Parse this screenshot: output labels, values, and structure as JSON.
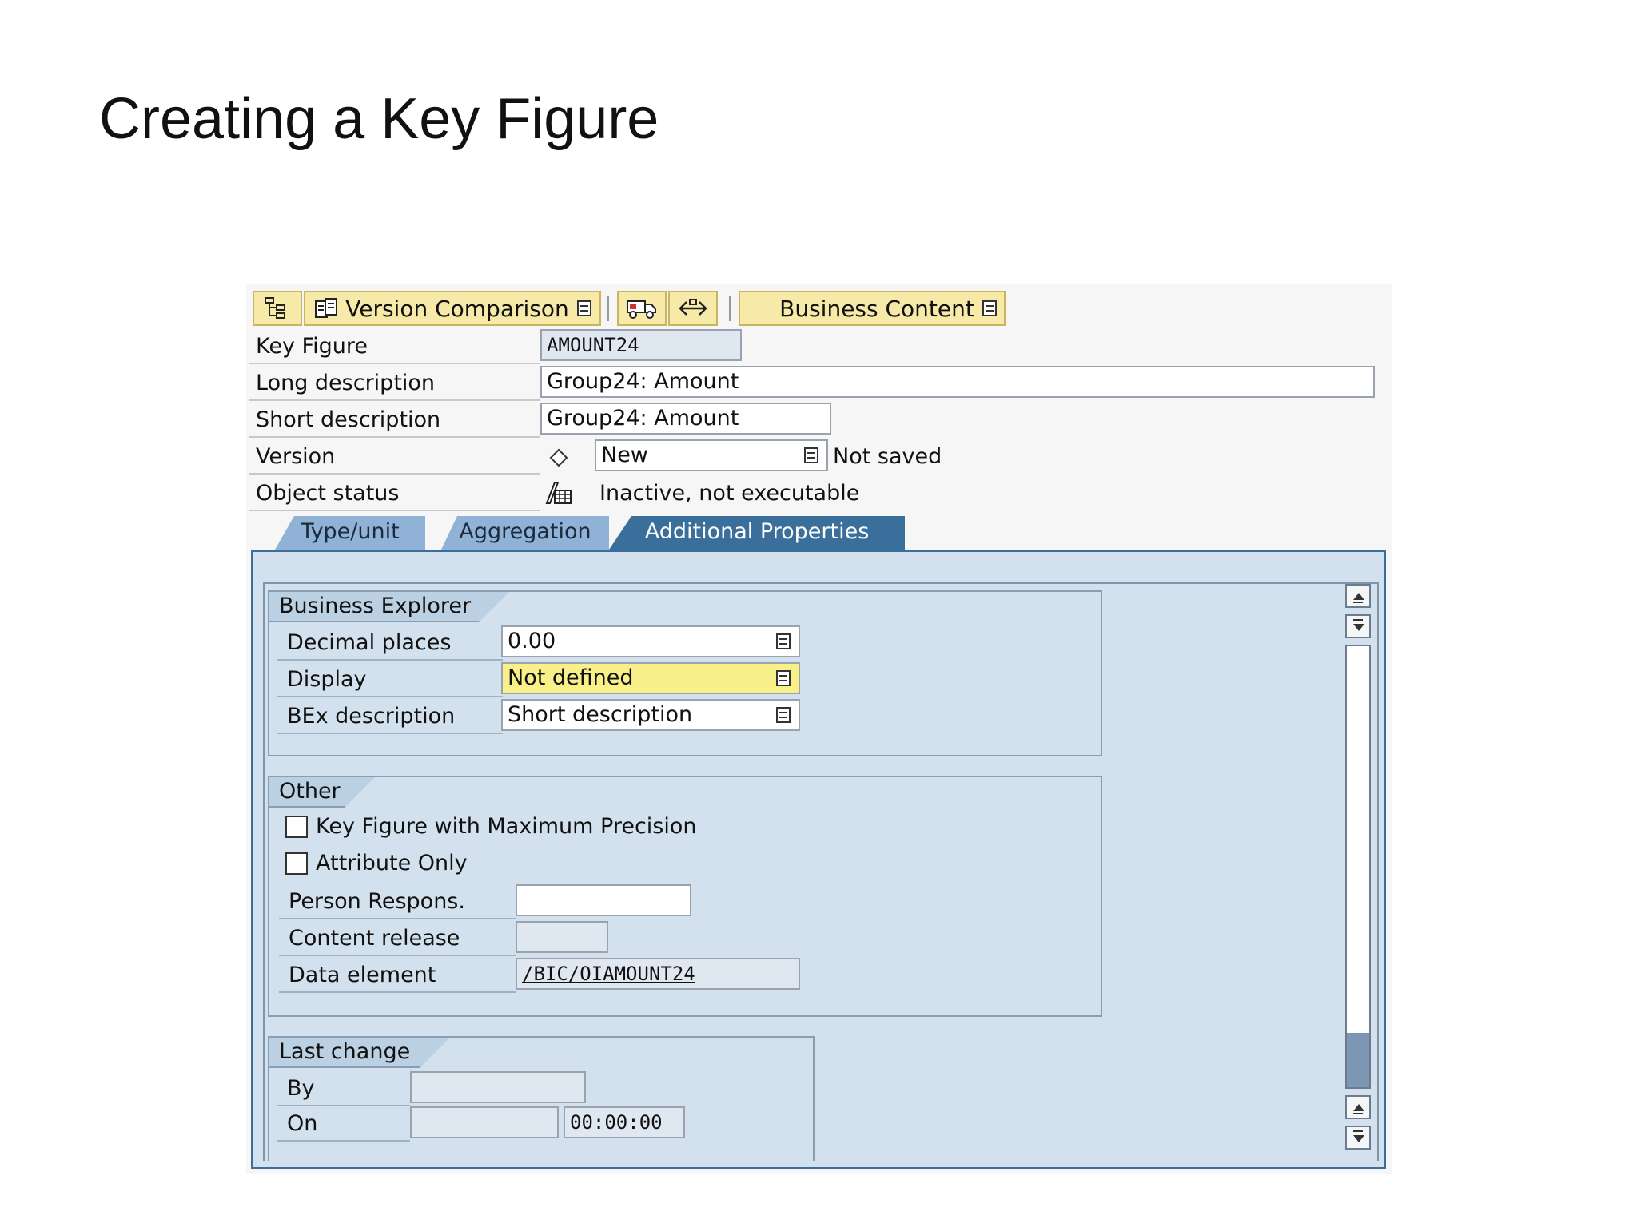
{
  "slide": {
    "title": "Creating a Key Figure"
  },
  "toolbar": {
    "version_comparison": "Version Comparison",
    "business_content": "Business Content"
  },
  "header": {
    "key_figure": {
      "label": "Key Figure",
      "value": "AMOUNT24"
    },
    "long_description": {
      "label": "Long description",
      "value": "Group24: Amount"
    },
    "short_description": {
      "label": "Short description",
      "value": "Group24: Amount"
    },
    "version": {
      "label": "Version",
      "value": "New",
      "status": "Not saved"
    },
    "object_status": {
      "label": "Object status",
      "value": "Inactive, not executable"
    }
  },
  "tabs": [
    {
      "label": "Type/unit",
      "active": false
    },
    {
      "label": "Aggregation",
      "active": false
    },
    {
      "label": "Additional Properties",
      "active": true
    }
  ],
  "business_explorer": {
    "title": "Business Explorer",
    "decimal_places": {
      "label": "Decimal places",
      "value": "0.00"
    },
    "display": {
      "label": "Display",
      "value": "Not defined"
    },
    "bex_description": {
      "label": "BEx description",
      "value": "Short description"
    }
  },
  "other": {
    "title": "Other",
    "max_precision": {
      "label": "Key Figure with Maximum Precision",
      "checked": false
    },
    "attribute_only": {
      "label": "Attribute Only",
      "checked": false
    },
    "person_respons": {
      "label": "Person Respons.",
      "value": ""
    },
    "content_release": {
      "label": "Content release",
      "value": ""
    },
    "data_element": {
      "label": "Data element",
      "value": "/BIC/OIAMOUNT24"
    }
  },
  "last_change": {
    "title": "Last change",
    "by": {
      "label": "By",
      "value": ""
    },
    "on": {
      "label": "On",
      "date": "",
      "time": "00:00:00"
    }
  },
  "colors": {
    "toolbar_button": "#f7eaa8",
    "active_tab": "#3a6f9c",
    "inactive_tab": "#90b2d6",
    "tab_body": "#d3e1ee",
    "required_field": "#faf08a"
  }
}
